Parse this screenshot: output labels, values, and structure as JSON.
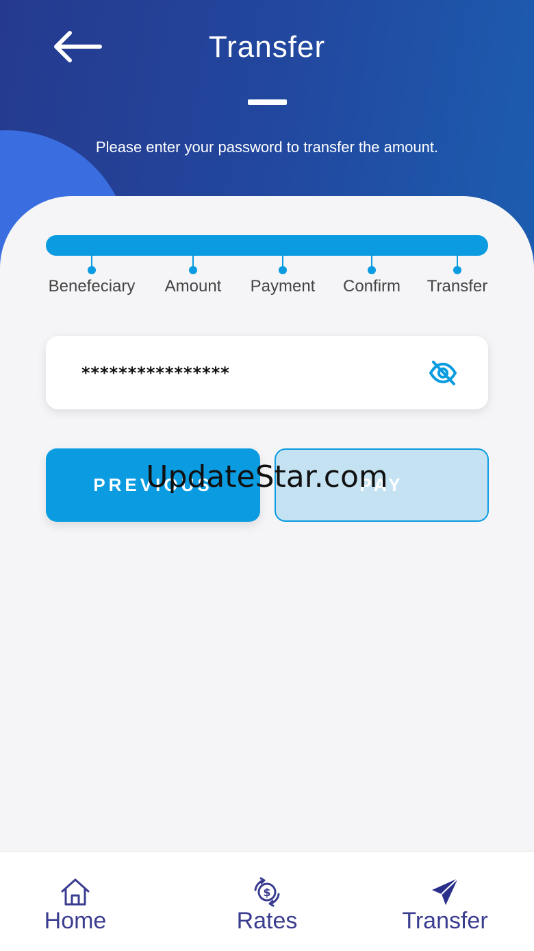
{
  "header": {
    "title": "Transfer",
    "subtitle": "Please enter your password to transfer the amount."
  },
  "steps": [
    "Benefeciary",
    "Amount",
    "Payment",
    "Confirm",
    "Transfer"
  ],
  "password": {
    "value": "****************"
  },
  "buttons": {
    "previous": "PREVIOUS",
    "pay": "PAY"
  },
  "watermark": "UpdateStar.com",
  "bottom_nav": {
    "home": "Home",
    "rates": "Rates",
    "transfer": "Transfer"
  },
  "colors": {
    "accent": "#0a9be0",
    "header_start": "#253a8e",
    "header_end": "#1c5db0",
    "nav_text": "#3a3d8f"
  },
  "icons": {
    "back": "arrow-left-icon",
    "visibility": "eye-off-icon",
    "home": "home-icon",
    "rates": "dollar-exchange-icon",
    "transfer": "send-icon"
  }
}
